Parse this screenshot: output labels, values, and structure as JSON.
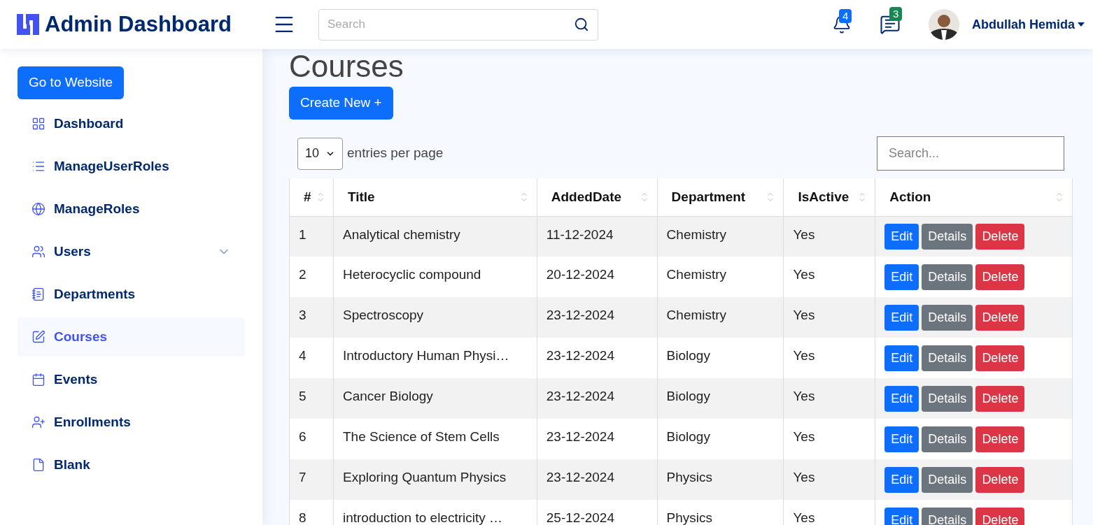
{
  "header": {
    "logo": "Admin Dashboard",
    "search": {
      "placeholder": "Search"
    },
    "notifications": "4",
    "messages": "3",
    "user": "Abdullah Hemida"
  },
  "sidebar": {
    "button": "Go to Website",
    "items": [
      {
        "label": "Dashboard",
        "selected": false
      },
      {
        "label": "ManageUserRoles",
        "selected": false
      },
      {
        "label": "ManageRoles",
        "selected": false
      },
      {
        "label": "Users",
        "selected": false
      },
      {
        "label": "Departments",
        "selected": false
      },
      {
        "label": "Courses",
        "selected": true
      },
      {
        "label": "Events",
        "selected": false
      },
      {
        "label": "Enrollments",
        "selected": false
      },
      {
        "label": "Blank",
        "selected": false
      }
    ]
  },
  "page": {
    "title": "Courses",
    "create_button": "Create New +",
    "page_size": "10",
    "page_size_label": "entries per page",
    "search": {
      "placeholder": "Search..."
    }
  },
  "table": {
    "columns": [
      "#",
      "Title",
      "AddedDate",
      "Department",
      "IsActive",
      "Action"
    ],
    "rows": [
      {
        "cells": [
          "1",
          "Analytical chemistry",
          "11-12-2024",
          "Chemistry",
          "Yes"
        ],
        "actions": [
          "Edit",
          "Details",
          "Delete"
        ]
      },
      {
        "cells": [
          "2",
          "Heterocyclic compound",
          "20-12-2024",
          "Chemistry",
          "Yes"
        ],
        "actions": [
          "Edit",
          "Details",
          "Delete"
        ]
      },
      {
        "cells": [
          "3",
          "Spectroscopy",
          "23-12-2024",
          "Chemistry",
          "Yes"
        ],
        "actions": [
          "Edit",
          "Details",
          "Delete"
        ]
      },
      {
        "cells": [
          "4",
          "Introductory Human Physi…",
          "23-12-2024",
          "Biology",
          "Yes"
        ],
        "actions": [
          "Edit",
          "Details",
          "Delete"
        ]
      },
      {
        "cells": [
          "5",
          "Cancer Biology",
          "23-12-2024",
          "Biology",
          "Yes"
        ],
        "actions": [
          "Edit",
          "Details",
          "Delete"
        ]
      },
      {
        "cells": [
          "6",
          "The Science of Stem Cells",
          "23-12-2024",
          "Biology",
          "Yes"
        ],
        "actions": [
          "Edit",
          "Details",
          "Delete"
        ]
      },
      {
        "cells": [
          "7",
          "Exploring Quantum Physics",
          "23-12-2024",
          "Physics",
          "Yes"
        ],
        "actions": [
          "Edit",
          "Details",
          "Delete"
        ]
      },
      {
        "cells": [
          "8",
          "introduction to electricity …",
          "25-12-2024",
          "Physics",
          "Yes"
        ],
        "actions": [
          "Edit",
          "Details",
          "Delete"
        ]
      }
    ]
  }
}
